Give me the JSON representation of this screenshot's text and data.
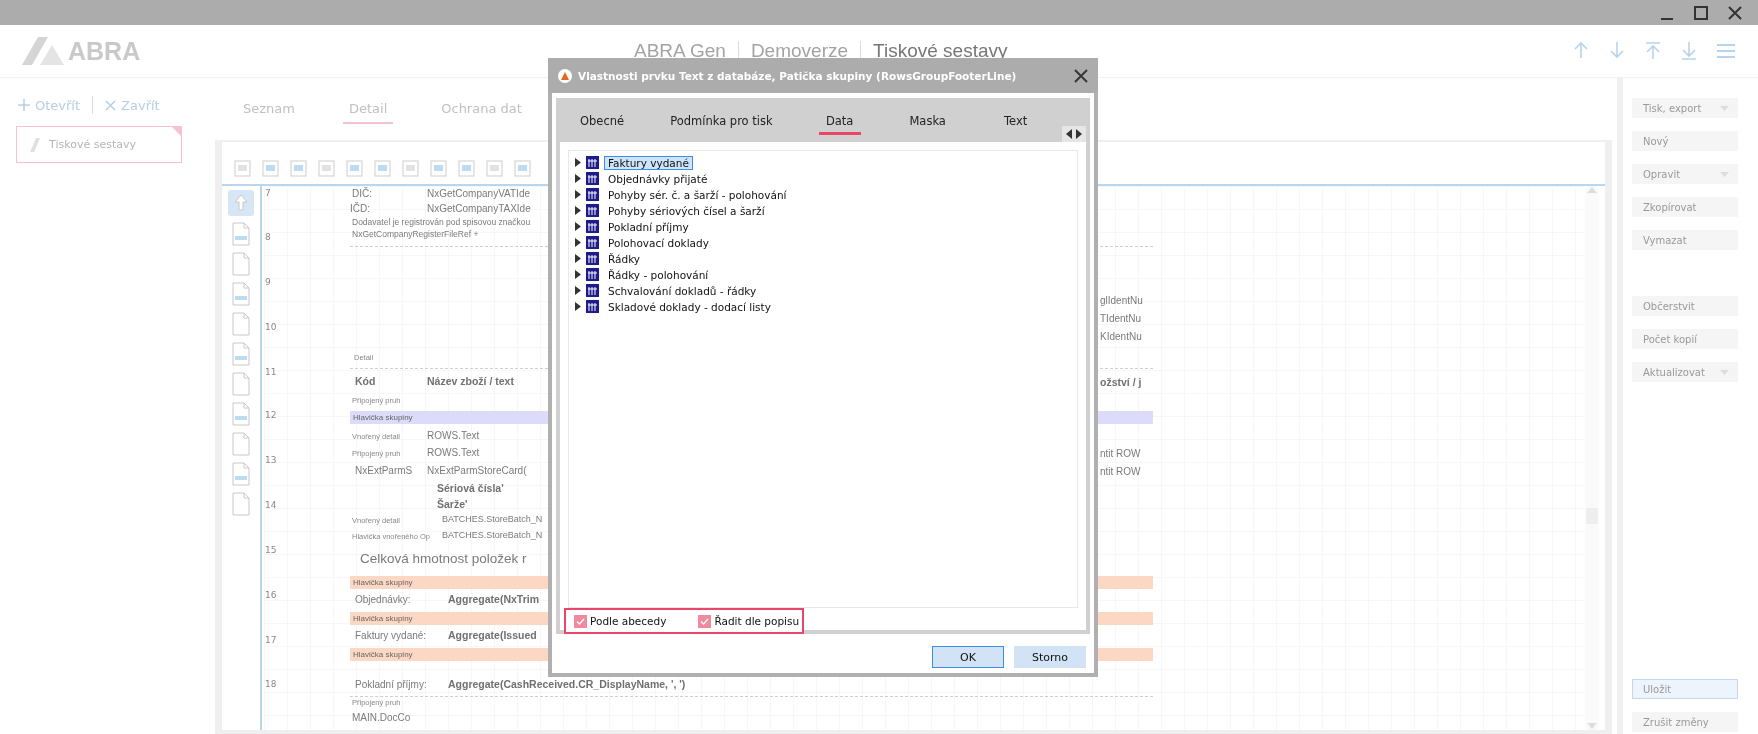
{
  "header": {
    "logo": "ABRA",
    "breadcrumb": [
      "ABRA Gen",
      "Demoverze",
      "Tiskové sestavy"
    ]
  },
  "sidebar": {
    "actions": [
      {
        "label": "Otevřít",
        "kind": "open"
      },
      {
        "label": "Zavřít",
        "kind": "close"
      }
    ],
    "items": [
      {
        "label": "Tiskové sestavy",
        "selected": true
      }
    ]
  },
  "tabs": [
    {
      "label": "Seznam",
      "selected": false
    },
    {
      "label": "Detail",
      "selected": true
    },
    {
      "label": "Ochrana dat",
      "selected": false
    }
  ],
  "designer": {
    "row_numbers": [
      "7",
      "8",
      "9",
      "10",
      "11",
      "12",
      "13",
      "14",
      "15",
      "16",
      "17",
      "18"
    ],
    "bands": [
      {
        "label": "Hlavička skupiny",
        "color": "#dcdcfa"
      },
      {
        "label": "Hlavička skupiny",
        "color": "#fcd8c4"
      },
      {
        "label": "Hlavička skupiny",
        "color": "#fcd8c4"
      },
      {
        "label": "Hlavička skupiny",
        "color": "#fcd8c4"
      }
    ],
    "elements": [
      {
        "text": "DIČ:",
        "kind": "label"
      },
      {
        "text": "NxGetCompanyVATIde",
        "kind": "label"
      },
      {
        "text": "IČD:",
        "kind": "label"
      },
      {
        "text": "NxGetCompanyTAXIde",
        "kind": "label"
      },
      {
        "text": "Dodavatel je registrován pod spisovou značkou",
        "kind": "small"
      },
      {
        "text": "NxGetCompanyRegisterFileRef +",
        "kind": "small"
      },
      {
        "text": "Detail",
        "kind": "caption"
      },
      {
        "text": "Kód",
        "kind": "heading"
      },
      {
        "text": "Název zboží / text",
        "kind": "heading"
      },
      {
        "text": "Připojený pruh",
        "kind": "caption"
      },
      {
        "text": "Vnořený detail",
        "kind": "caption"
      },
      {
        "text": "ROWS.Text",
        "kind": "label"
      },
      {
        "text": "Připojený pruh",
        "kind": "caption"
      },
      {
        "text": "ROWS.Text",
        "kind": "label"
      },
      {
        "text": "NxExtParmS",
        "kind": "label"
      },
      {
        "text": "NxExtParmStoreCard(",
        "kind": "label"
      },
      {
        "text": "Sériová čísla'",
        "kind": "strong"
      },
      {
        "text": "Šarže'",
        "kind": "strong"
      },
      {
        "text": "Vnořený detail",
        "kind": "caption"
      },
      {
        "text": "BATCHES.StoreBatch_N",
        "kind": "label"
      },
      {
        "text": "Hlavička vnořeného Op",
        "kind": "caption"
      },
      {
        "text": "BATCHES.StoreBatch_N",
        "kind": "label"
      },
      {
        "text": "Celková hmotnost položek r",
        "kind": "title"
      },
      {
        "text": "Objednávky:",
        "kind": "label"
      },
      {
        "text": "Aggregate(NxTrim",
        "kind": "heading"
      },
      {
        "text": "Faktury vydané:",
        "kind": "label"
      },
      {
        "text": "Aggregate(Issued",
        "kind": "heading"
      },
      {
        "text": "Pokladní příjmy:",
        "kind": "label"
      },
      {
        "text": "Aggregate(CashReceived.CR_DisplayName, ', ')",
        "kind": "heading"
      },
      {
        "text": "Připojený pruh",
        "kind": "caption"
      },
      {
        "text": "MAIN.DocCo",
        "kind": "label"
      },
      {
        "text": "glIdentNu",
        "kind": "label"
      },
      {
        "text": "TIdentNu",
        "kind": "label"
      },
      {
        "text": "KIdentNu",
        "kind": "label"
      },
      {
        "text": "ožství / j",
        "kind": "heading"
      },
      {
        "text": "ntit ROW",
        "kind": "label"
      },
      {
        "text": "ntit ROW",
        "kind": "label"
      }
    ]
  },
  "actions": [
    {
      "label": "Tisk, export",
      "kind": "menu"
    },
    {
      "label": "Nový",
      "kind": "plain"
    },
    {
      "label": "Opravit",
      "kind": "menu"
    },
    {
      "label": "Zkopírovat",
      "kind": "plain"
    },
    {
      "label": "Vymazat",
      "kind": "plain"
    },
    {
      "label": "Občerstvit",
      "kind": "plain"
    },
    {
      "label": "Počet kopií",
      "kind": "plain"
    },
    {
      "label": "Aktualizovat",
      "kind": "menu"
    }
  ],
  "bottom_actions": [
    {
      "label": "Uložit",
      "kind": "focused"
    },
    {
      "label": "Zrušit změny",
      "kind": "plain"
    }
  ],
  "dialog": {
    "title": "Vlastnosti prvku Text z databáze, Patička skupiny (RowsGroupFooterLine)",
    "tabs": [
      {
        "label": "Obecné",
        "selected": false
      },
      {
        "label": "Podmínka pro tisk",
        "selected": false
      },
      {
        "label": "Data",
        "selected": true
      },
      {
        "label": "Maska",
        "selected": false
      },
      {
        "label": "Text",
        "selected": false
      }
    ],
    "tree": [
      {
        "label": "Faktury vydané",
        "selected": true
      },
      {
        "label": "Objednávky přijaté",
        "selected": false
      },
      {
        "label": "Pohyby sér. č. a šarží - polohování",
        "selected": false
      },
      {
        "label": "Pohyby sériových čísel a šarží",
        "selected": false
      },
      {
        "label": "Pokladní příjmy",
        "selected": false
      },
      {
        "label": "Polohovací doklady",
        "selected": false
      },
      {
        "label": "Řádky",
        "selected": false
      },
      {
        "label": "Řádky - polohování",
        "selected": false
      },
      {
        "label": "Schvalování dokladů - řádky",
        "selected": false
      },
      {
        "label": "Skladové doklady - dodací listy",
        "selected": false
      }
    ],
    "options": [
      {
        "label": "Podle abecedy",
        "checked": true
      },
      {
        "label": "Řadit dle popisu",
        "checked": true
      }
    ],
    "buttons": [
      {
        "label": "OK",
        "kind": "default"
      },
      {
        "label": "Storno",
        "kind": "normal"
      }
    ]
  }
}
